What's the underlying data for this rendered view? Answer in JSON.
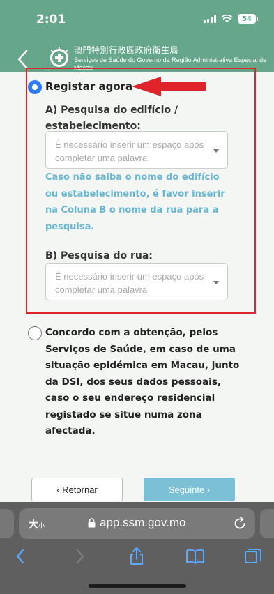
{
  "status": {
    "time": "2:01",
    "battery": "54"
  },
  "header": {
    "org_cn": "澳門特別行政區政府衛生局",
    "org_pt": "Serviços de Saúde do Governo da Região Administrativa Especial de Macau"
  },
  "form": {
    "option_register": "Registar agora",
    "section_a_label": "A) Pesquisa do edifício / estabelecimento:",
    "section_a_placeholder": "É necessário inserir um espaço após completar uma palavra",
    "hint": "Caso não saiba o nome do edifício ou estabelecimento, é favor inserir na Coluna B o nome da rua para a pesquisa.",
    "section_b_label": "B) Pesquisa do rua:",
    "section_b_placeholder": "É necessário inserir um espaço após completar uma palavra",
    "option_consent": "Concordo com a obtenção, pelos Serviços de Saúde, em caso de uma situação epidémica em Macau, junto da DSI, dos seus dados pessoais, caso o seu endereço residencial registado se situe numa zona afectada."
  },
  "buttons": {
    "back": "‹ Retornar",
    "next": "Seguinte ›"
  },
  "browser": {
    "text_size_big": "大",
    "text_size_small": "小",
    "url": "app.ssm.gov.mo"
  },
  "colors": {
    "header_green": "#66a68b",
    "annotation_red": "#e0242c",
    "radio_blue": "#2d7cf6",
    "hint_blue": "#69b6d3",
    "next_button": "#7cc0d6"
  },
  "icons": [
    "back-chevron-icon",
    "health-logo-icon",
    "annotation-arrow-icon",
    "dropdown-caret-icon",
    "lock-icon",
    "reload-icon",
    "browser-back-icon",
    "browser-forward-icon",
    "share-icon",
    "bookmarks-icon",
    "tabs-icon"
  ]
}
